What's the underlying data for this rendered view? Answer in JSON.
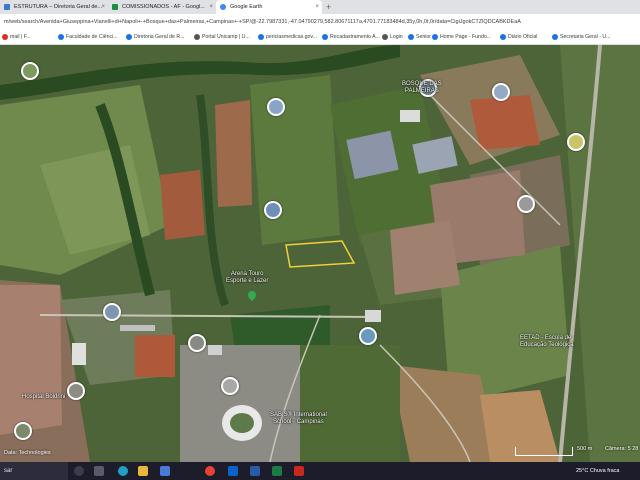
{
  "browser": {
    "tabs": [
      {
        "label": "ESTRUTURA -- Diretoria Geral de...",
        "color": "#3a76d8"
      },
      {
        "label": "COMISSIONADOS - AF - Googl...",
        "color": "#1e8e3e"
      },
      {
        "label": "Google Earth",
        "color": "#4285f4"
      }
    ],
    "new_tab": "+",
    "close_glyph": "×",
    "url": "m/web/search/Avenida+Giuseppina+Vianelli+di+Napoli+-+Bosque+das+Palmeiras,+Campinas+-+SP/@-22.7987331,-47.04790279,582.80671117a,4701.77183484d,35y,0h,0t,0r/data=CigiJgokCTZlQDCABKDEaA",
    "bookmarks": [
      {
        "label": "mail | F...",
        "color": "#d93025"
      },
      {
        "label": "Faculdade de Ciênci...",
        "color": "#1a73e8"
      },
      {
        "label": "Diretoria Geral de R...",
        "color": "#1a73e8"
      },
      {
        "label": "Portal Unicamp | U...",
        "color": "#555555"
      },
      {
        "label": "periciasmedicas.gov...",
        "color": "#1a73e8"
      },
      {
        "label": "Recadastramento A...",
        "color": "#1a73e8"
      },
      {
        "label": "Login",
        "color": "#555555"
      },
      {
        "label": "Senior",
        "color": "#1a73e8"
      },
      {
        "label": "Home Page - Fundo...",
        "color": "#1a73e8"
      },
      {
        "label": "Diário Oficial",
        "color": "#1a73e8"
      },
      {
        "label": "Secretaria Geral - U...",
        "color": "#1a73e8"
      }
    ]
  },
  "map": {
    "labels": {
      "bosque": "BOSQUE DAS\nPALMEIRAS",
      "arena": "Arena Touro\nEsporte e Lazer",
      "eetad": "EETAD - Escola de\nEducação Teológica",
      "hospital": "Hospital Boldrini",
      "sabis": "SABIS® International\nSchool - Campinas"
    },
    "highlight_color": "#f2d03b",
    "scale_label": "500 m",
    "camera_label": "Câmera: 5 28",
    "data_source": "Data: Technologies"
  },
  "taskbar": {
    "search_label": "sar",
    "weather": "25°C  Chuva fraca",
    "icons": [
      "search-app-icon",
      "task-view-icon",
      "edge-icon",
      "explorer-icon",
      "store-icon",
      "chrome-icon",
      "outlook-icon",
      "word-icon",
      "excel-icon",
      "pdf-icon"
    ]
  }
}
